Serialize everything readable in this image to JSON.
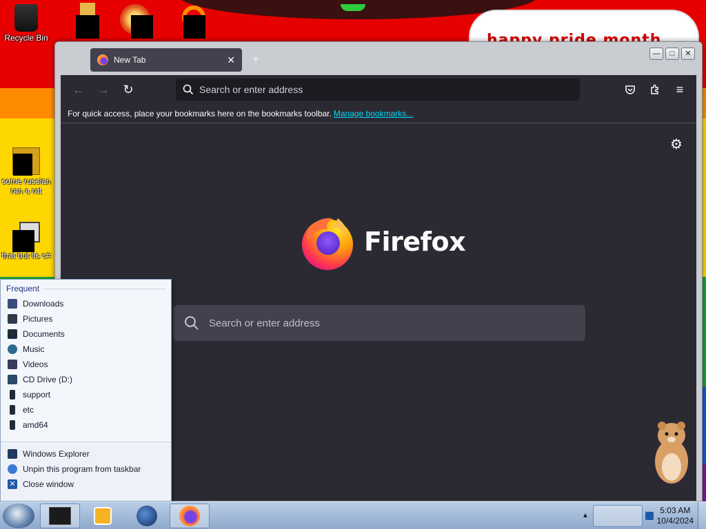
{
  "desktop": {
    "banner_text": "happy pride month",
    "icons": [
      {
        "label": "Recycle Bin"
      },
      {
        "label": ""
      },
      {
        "label": ""
      },
      {
        "label": ""
      },
      {
        "label": "some russian ran a rat"
      },
      {
        "label": "that but its c#"
      }
    ]
  },
  "window": {
    "tab_title": "New Tab",
    "controls": {
      "minimize": "—",
      "maximize": "□",
      "close": "✕"
    }
  },
  "browser": {
    "url_placeholder": "Search or enter address",
    "bookmarks_prompt": "For quick access, place your bookmarks here on the bookmarks toolbar.",
    "bookmarks_link": "Manage bookmarks...",
    "wordmark": "Firefox",
    "search_placeholder": "Search or enter address"
  },
  "jumplist": {
    "heading": "Frequent",
    "frequent": [
      {
        "label": "Downloads",
        "color": "#3a4a7a"
      },
      {
        "label": "Pictures",
        "color": "#2d3a4a"
      },
      {
        "label": "Documents",
        "color": "#1d2a3a"
      },
      {
        "label": "Music",
        "color": "#2a6a8a"
      },
      {
        "label": "Videos",
        "color": "#3a3a5a"
      },
      {
        "label": "CD Drive (D:)",
        "color": "#2a4a6a"
      },
      {
        "label": "support",
        "color": "#222a3a"
      },
      {
        "label": "etc",
        "color": "#222a3a"
      },
      {
        "label": "amd64",
        "color": "#222a3a"
      }
    ],
    "tasks": [
      {
        "label": "Windows Explorer",
        "color": "#1e3a5f"
      },
      {
        "label": "Unpin this program from taskbar",
        "color": "#3a7bd5"
      },
      {
        "label": "Close window",
        "color": "#1f5aa8"
      }
    ]
  },
  "taskbar": {
    "time": "5:03 AM",
    "date": "10/4/2024"
  }
}
